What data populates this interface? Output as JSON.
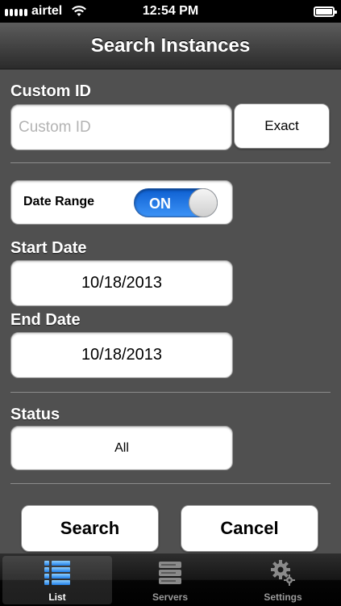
{
  "status_bar": {
    "carrier": "airtel",
    "time": "12:54 PM"
  },
  "nav": {
    "title": "Search Instances"
  },
  "custom_id": {
    "label": "Custom ID",
    "placeholder": "Custom ID",
    "value": "",
    "exact_button": "Exact"
  },
  "date_range": {
    "label": "Date Range",
    "toggle_text": "ON",
    "enabled": true
  },
  "start_date": {
    "label": "Start Date",
    "value": "10/18/2013"
  },
  "end_date": {
    "label": "End Date",
    "value": "10/18/2013"
  },
  "status": {
    "label": "Status",
    "value": "All"
  },
  "actions": {
    "search": "Search",
    "cancel": "Cancel"
  },
  "tabs": [
    {
      "label": "List",
      "icon": "list-icon",
      "active": true
    },
    {
      "label": "Servers",
      "icon": "servers-icon",
      "active": false
    },
    {
      "label": "Settings",
      "icon": "settings-gear-icon",
      "active": false
    }
  ],
  "colors": {
    "toggle_on": "#1a6fe0",
    "background": "#505050",
    "nav": "#2b2b2b"
  }
}
